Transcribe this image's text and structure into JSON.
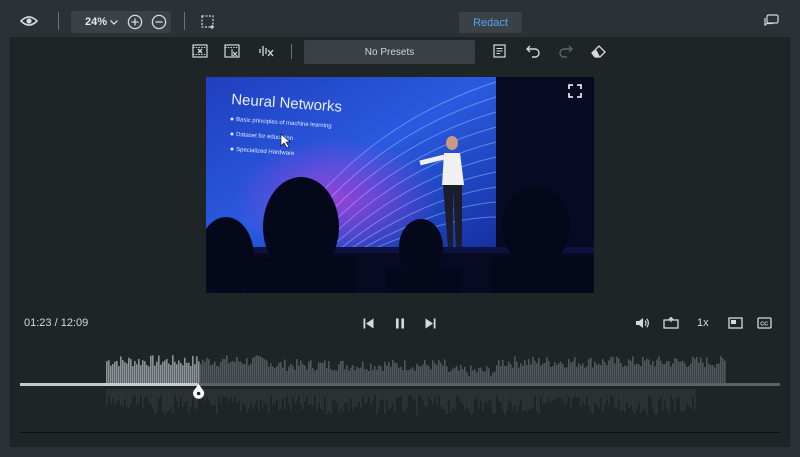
{
  "toolbar": {
    "zoom_value": "24%",
    "redact_label": "Redact"
  },
  "editor_toolbar": {
    "preset_label": "No Presets"
  },
  "video": {
    "slide_title": "Neural Networks",
    "bullets": [
      "Basic principles of machine learning",
      "Dataset for education",
      "Specialized Hardware"
    ]
  },
  "player": {
    "timecode": "01:23 / 12:09",
    "speed": "1x",
    "progress": 0.235
  },
  "colors": {
    "accent": "#5aa2ee",
    "background": "#2b3135",
    "panel": "#1f2427"
  }
}
